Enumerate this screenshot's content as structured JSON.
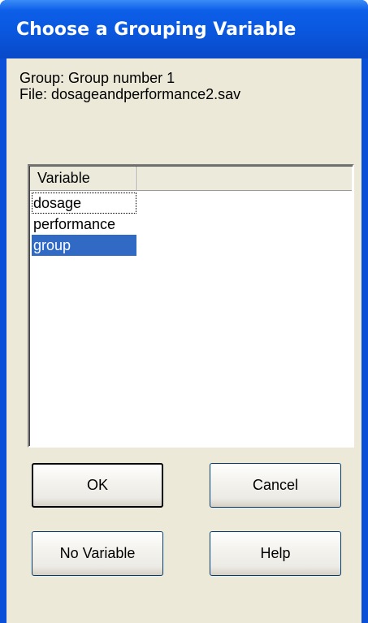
{
  "window": {
    "title": "Choose a Grouping Variable"
  },
  "info": {
    "group_line": "Group: Group number 1",
    "file_line": "File: dosageandperformance2.sav"
  },
  "variable_list": {
    "column_header": "Variable",
    "items": [
      "dosage",
      "performance",
      "group"
    ],
    "selected": "group",
    "focused": "dosage"
  },
  "buttons": {
    "ok": "OK",
    "cancel": "Cancel",
    "no_variable": "No Variable",
    "help": "Help"
  },
  "colors": {
    "title_bar": "#0a57de",
    "dialog_face": "#ece9d8",
    "selection": "#316ac5"
  }
}
